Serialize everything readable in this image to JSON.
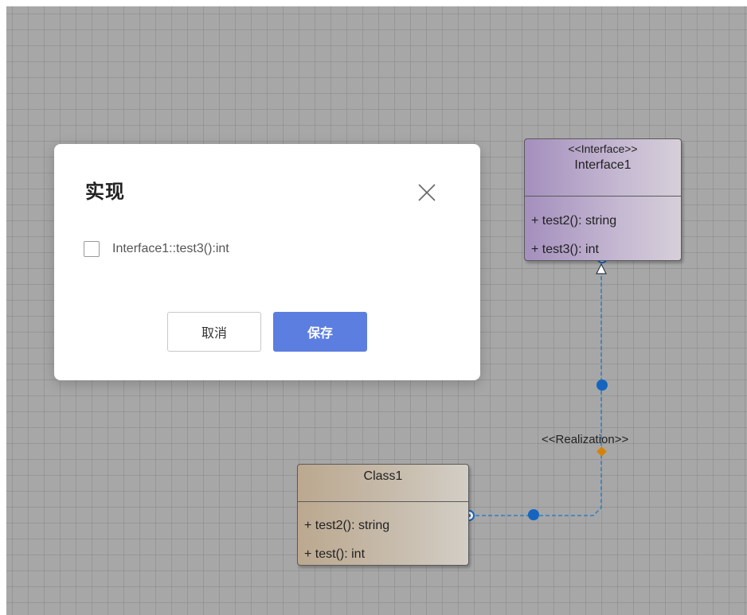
{
  "dialog": {
    "title": "实现",
    "option_label": "Interface1::test3():int",
    "option_checked": false,
    "cancel_label": "取消",
    "save_label": "保存",
    "accent_color": "#5c7ee0"
  },
  "diagram": {
    "interface": {
      "stereotype": "<<Interface>>",
      "name": "Interface1",
      "members": [
        "+ test2(): string",
        "+ test3(): int"
      ],
      "fill_color": "#a48fbd"
    },
    "class": {
      "name": "Class1",
      "members": [
        "+ test2(): string",
        "+ test(): int"
      ],
      "fill_color": "#bba88f"
    },
    "relation": {
      "label": "<<Realization>>",
      "line_color": "#2f7fc1",
      "handle_color": "#1565c0",
      "label_anchor_color": "#d4830a"
    }
  }
}
